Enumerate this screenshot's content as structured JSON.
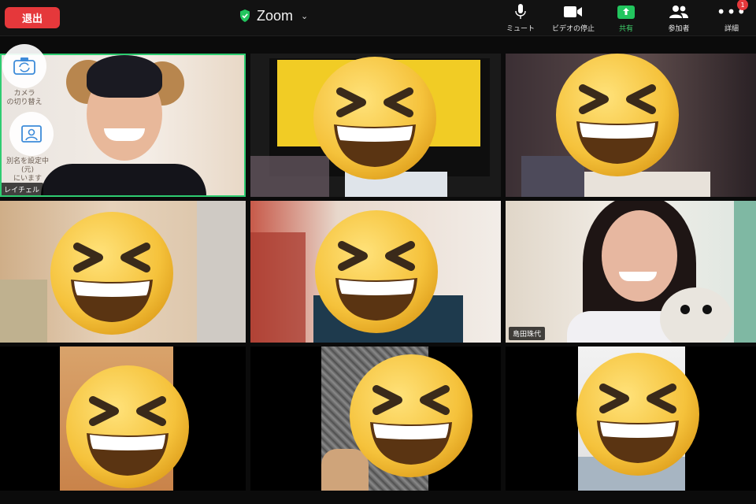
{
  "topbar": {
    "leave_label": "退出",
    "app_title": "Zoom",
    "tools": [
      {
        "name": "mute",
        "label": "ミュート",
        "icon": "microphone-icon"
      },
      {
        "name": "video",
        "label": "ビデオの停止",
        "icon": "video-camera-icon"
      },
      {
        "name": "share",
        "label": "共有",
        "icon": "share-screen-icon"
      },
      {
        "name": "participants",
        "label": "参加者",
        "icon": "participants-icon"
      },
      {
        "name": "more",
        "label": "詳細",
        "icon": "more-dots-icon",
        "badge": "1"
      }
    ]
  },
  "side_controls": {
    "switch_camera_label": "カメラ\nの切り替え",
    "background_label": "別名を設定中\n(元)\nにいます",
    "self_name": "レイチェル"
  },
  "tiles": [
    {
      "name_tag": "島田珠代"
    }
  ],
  "colors": {
    "accent_green": "#22c55e",
    "leave_red": "#e5383b",
    "emoji_yellow": "#f5c23b"
  }
}
